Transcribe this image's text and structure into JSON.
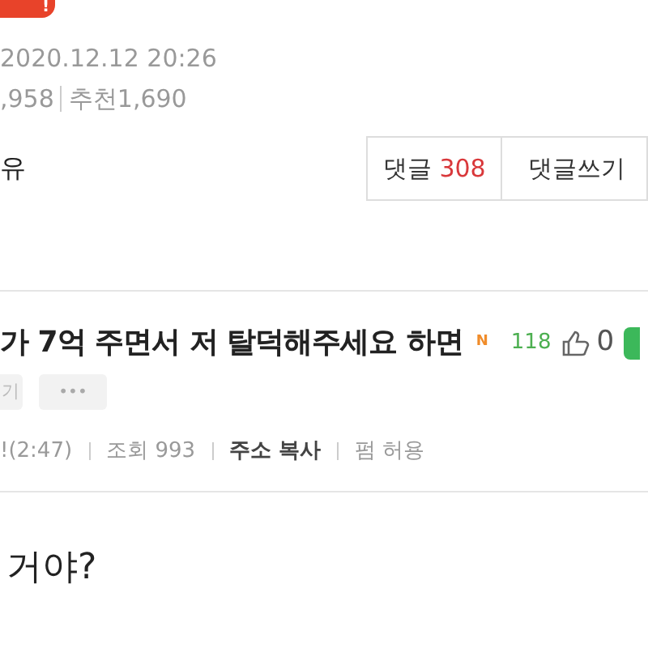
{
  "post": {
    "badge": "!",
    "date": "2020.12.12 20:26",
    "views": ",958",
    "recommend": "추천1,690",
    "author_fragment": "유"
  },
  "buttons": [
    {
      "label": "댓글",
      "count": "308"
    },
    {
      "label": "댓글쓰기"
    }
  ],
  "article": {
    "title": "가 7억 주면서 저 탈덕해주세요 하면",
    "new_mark": "N",
    "comment_count": "118",
    "likes": "0",
    "actions": [
      "기",
      "•••"
    ],
    "meta": [
      "!(2:47)",
      "조회 993",
      "주소 복사",
      "펌 허용"
    ],
    "body": "거야?"
  }
}
